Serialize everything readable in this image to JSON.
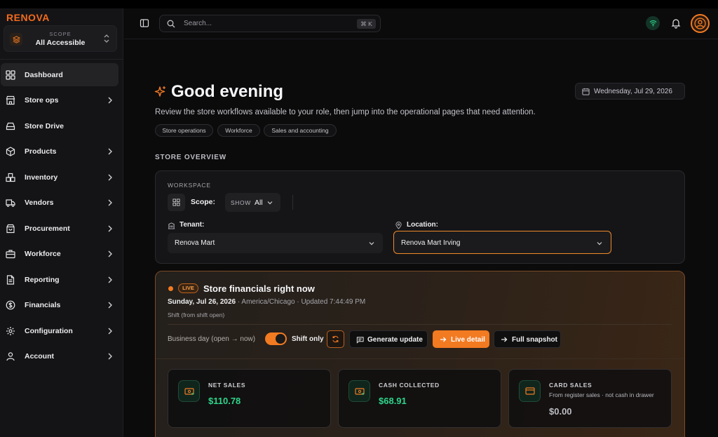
{
  "brand": "RENOVA",
  "scope": {
    "label": "SCOPE",
    "value": "All Accessible"
  },
  "sidebar": {
    "items": [
      {
        "label": "Dashboard",
        "icon": "dashboard-grid-icon",
        "active": true
      },
      {
        "label": "Store ops",
        "icon": "store-icon",
        "chevron": true
      },
      {
        "label": "Store Drive",
        "icon": "drive-icon"
      },
      {
        "label": "Products",
        "icon": "package-icon",
        "chevron": true
      },
      {
        "label": "Inventory",
        "icon": "boxes-icon",
        "chevron": true
      },
      {
        "label": "Vendors",
        "icon": "truck-icon",
        "chevron": true
      },
      {
        "label": "Procurement",
        "icon": "shopping-bag-icon",
        "chevron": true
      },
      {
        "label": "Workforce",
        "icon": "briefcase-icon",
        "chevron": true
      },
      {
        "label": "Reporting",
        "icon": "report-document-icon",
        "chevron": true
      },
      {
        "label": "Financials",
        "icon": "dollar-circle-icon",
        "chevron": true
      },
      {
        "label": "Configuration",
        "icon": "gear-icon",
        "chevron": true
      },
      {
        "label": "Account",
        "icon": "user-icon",
        "chevron": true
      }
    ]
  },
  "topbar": {
    "search_placeholder": "Search...",
    "shortcut": "⌘ K"
  },
  "greeting": {
    "title": "Good evening",
    "subtitle": "Review the store workflows available to your role, then jump into the operational pages that need attention.",
    "date": "Wednesday, Jul 29, 2026",
    "chips": [
      "Store operations",
      "Workforce",
      "Sales and accounting"
    ]
  },
  "overview": {
    "section_title": "STORE OVERVIEW",
    "workspace_label": "WORKSPACE",
    "scope_label": "Scope:",
    "show_label": "SHOW",
    "show_value": "All",
    "tenant_label": "Tenant:",
    "tenant_value": "Renova Mart",
    "location_label": "Location:",
    "location_value": "Renova Mart Irving"
  },
  "financials": {
    "badge": "LIVE",
    "title": "Store financials right now",
    "date": "Sunday, Jul 26, 2026",
    "meta": "· America/Chicago · Updated 7:44:49 PM",
    "shift_note": "Shift (from shift open)",
    "business_day": "Business day (open → now)",
    "shift_only_label": "Shift only",
    "shift_only_on": true,
    "buttons": {
      "generate": "Generate update",
      "live": "Live detail",
      "snapshot": "Full snapshot"
    },
    "metrics": [
      {
        "label": "NET SALES",
        "value": "$110.78",
        "sub": ""
      },
      {
        "label": "CASH COLLECTED",
        "value": "$68.91",
        "sub": ""
      },
      {
        "label": "CARD SALES",
        "value": "$0.00",
        "sub": "From register sales · not cash in drawer"
      }
    ]
  },
  "colors": {
    "accent": "#f27a21",
    "positive": "#2ed48a",
    "background": "#0b0b0c"
  }
}
